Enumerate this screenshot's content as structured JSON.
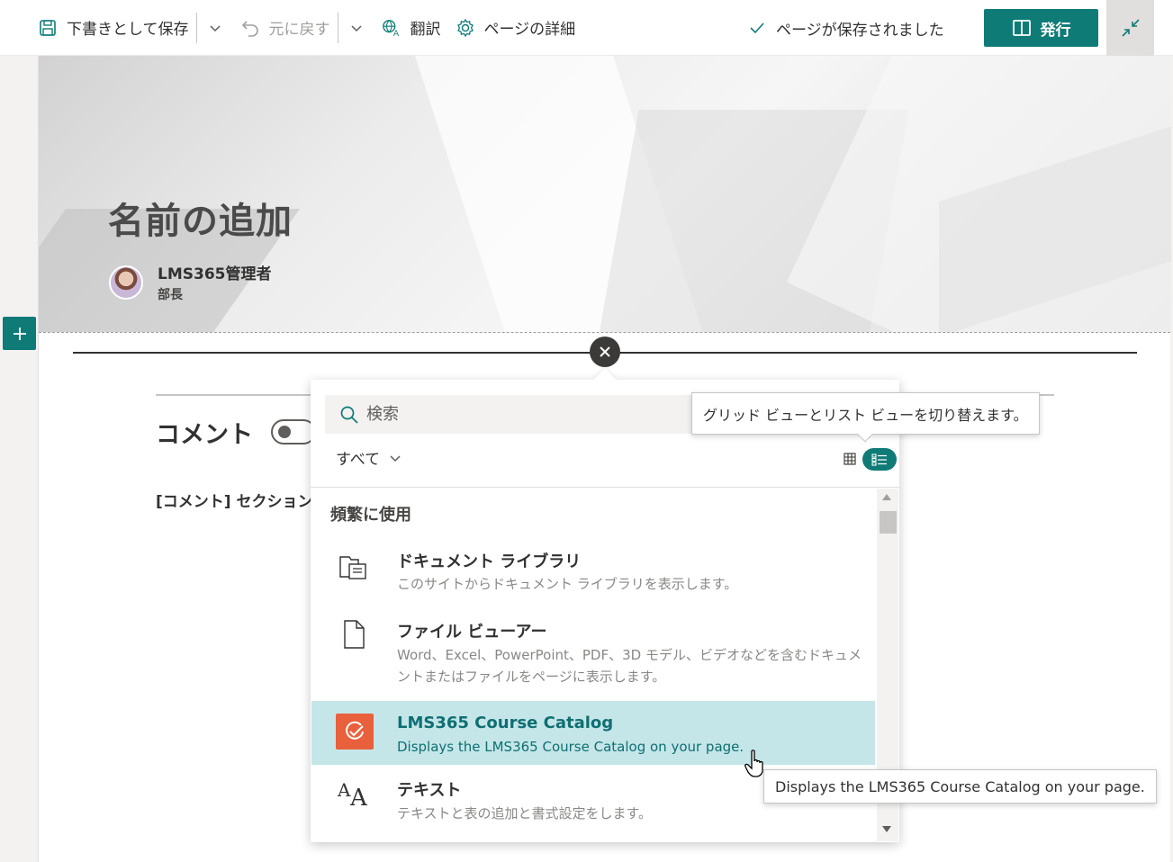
{
  "toolbar": {
    "save_draft": "下書きとして保存",
    "undo": "元に戻す",
    "translate": "翻訳",
    "page_details": "ページの詳細",
    "saved_status": "ページが保存されました",
    "publish": "発行"
  },
  "hero": {
    "title": "名前の追加",
    "author_name": "LMS365管理者",
    "author_role": "部長"
  },
  "comments": {
    "title": "コメント",
    "note": "[コメント] セクション"
  },
  "toolbox": {
    "search_placeholder": "検索",
    "filter_label": "すべて",
    "section_title": "頻繁に使用",
    "items": [
      {
        "title": "ドキュメント ライブラリ",
        "description": "このサイトからドキュメント ライブラリを表示します。",
        "icon": "document-library-icon"
      },
      {
        "title": "ファイル ビューアー",
        "description": "Word、Excel、PowerPoint、PDF、3D モデル、ビデオなどを含むドキュメントまたはファイルをページに表示します。",
        "icon": "file-icon"
      },
      {
        "title": "LMS365 Course Catalog",
        "description": "Displays the LMS365 Course Catalog on your page.",
        "icon": "lms365-icon"
      },
      {
        "title": "テキスト",
        "description": "テキストと表の追加と書式設定をします。",
        "icon": "text-icon"
      }
    ]
  },
  "tooltips": {
    "view_toggle": "グリッド ビューとリスト ビューを切り替えます。",
    "item_hover": "Displays the LMS365 Course Catalog on your page."
  },
  "colors": {
    "accent": "#0f7b77",
    "selected_row": "#c5e6e8",
    "lms365_icon": "#e8603c"
  }
}
